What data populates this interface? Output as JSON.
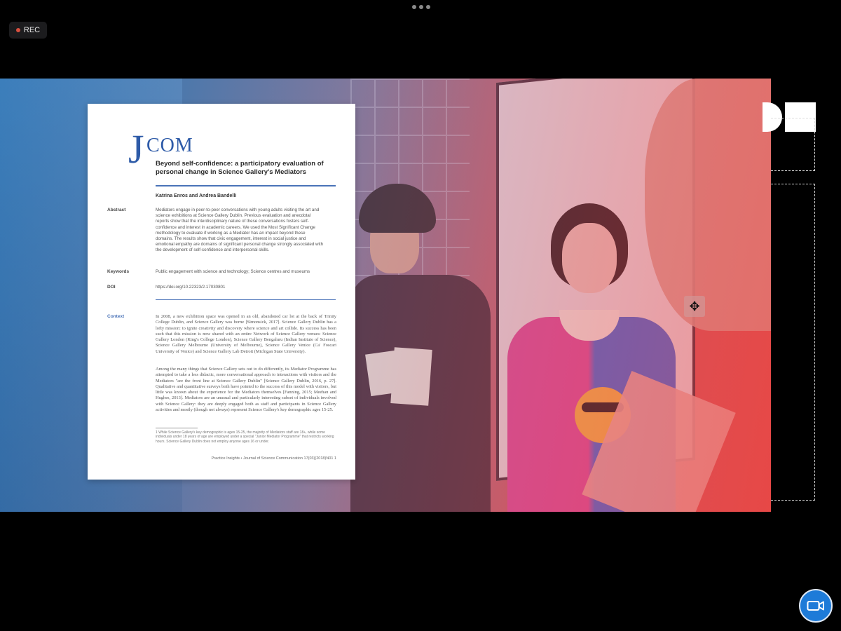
{
  "recording": {
    "label": "REC"
  },
  "paper": {
    "logo": {
      "j": "J",
      "rest": "COM"
    },
    "title": "Beyond self-confidence: a participatory evaluation of personal change in Science Gallery's Mediators",
    "authors": "Katrina Enros and Andrea Bandelli",
    "abstract_label": "Abstract",
    "abstract": "Mediators engage in peer-to-peer conversations with young adults visiting the art and science exhibitions at Science Gallery Dublin. Previous evaluation and anecdotal reports show that the interdisciplinary nature of these conversations fosters self-confidence and interest in academic careers. We used the Most Significant Change methodology to evaluate if working as a Mediator has an impact beyond these domains. The results show that civic engagement, interest in social justice and emotional empathy are domains of significant personal change strongly associated with the development of self-confidence and interpersonal skills.",
    "keywords_label": "Keywords",
    "keywords": "Public engagement with science and technology; Science centres and museums",
    "doi_label": "DOI",
    "doi": "https://doi.org/10.22323/2.17030801",
    "context_label": "Context",
    "body_p1": "In 2008, a new exhibition space was opened in an old, abandoned car lot at the back of Trinity College Dublin, and Science Gallery was borne [Simonsick, 2017]. Science Gallery Dublin has a lofty mission: to ignite creativity and discovery where science and art collide. Its success has been such that this mission is now shared with an entire Network of Science Gallery venues: Science Gallery London (King's College London), Science Gallery Bengaluru (Indian Institute of Science), Science Gallery Melbourne (University of Melbourne), Science Gallery Venice (Ca' Foscari University of Venice) and Science Gallery Lab Detroit (Michigan State University).",
    "body_p2": "Among the many things that Science Gallery sets out to do differently, its Mediator Programme has attempted to take a less didactic, more conversational approach to interactions with visitors and the Mediators \"are the front line at Science Gallery Dublin\" [Science Gallery Dublin, 2016, p. 27]. Qualitative and quantitative surveys both have pointed to the success of this model with visitors, but little was known about the experience for the Mediators themselves [Fanning, 2015; Meehan and Hughes, 2013]. Mediators are an unusual and particularly interesting subset of individuals involved with Science Gallery: they are deeply engaged both as staff and participants in Science Gallery activities and mostly (though not always) represent Science Gallery's key demographic ages 15-25.",
    "footnote": "1 While Science Gallery's key demographic is ages 15-25, the majority of Mediators staff are 18+, while some individuals under 18 years of age are employed under a special \"Junior Mediator Programme\" that restricts working hours. Science Gallery Dublin does not employ anyone ages 16 or under.",
    "footer": "Practice Insights  •  Journal of Science Communication 17(03)(2018)N01  1"
  },
  "icons": {
    "more": "more-dots-icon",
    "camera": "video-camera-icon",
    "cursor": "move-cursor-icon"
  },
  "colors": {
    "background": "#000000",
    "accent": "#1e7bd8",
    "jcom_blue": "#2e5ba8",
    "rec_dot": "#d9503f"
  }
}
